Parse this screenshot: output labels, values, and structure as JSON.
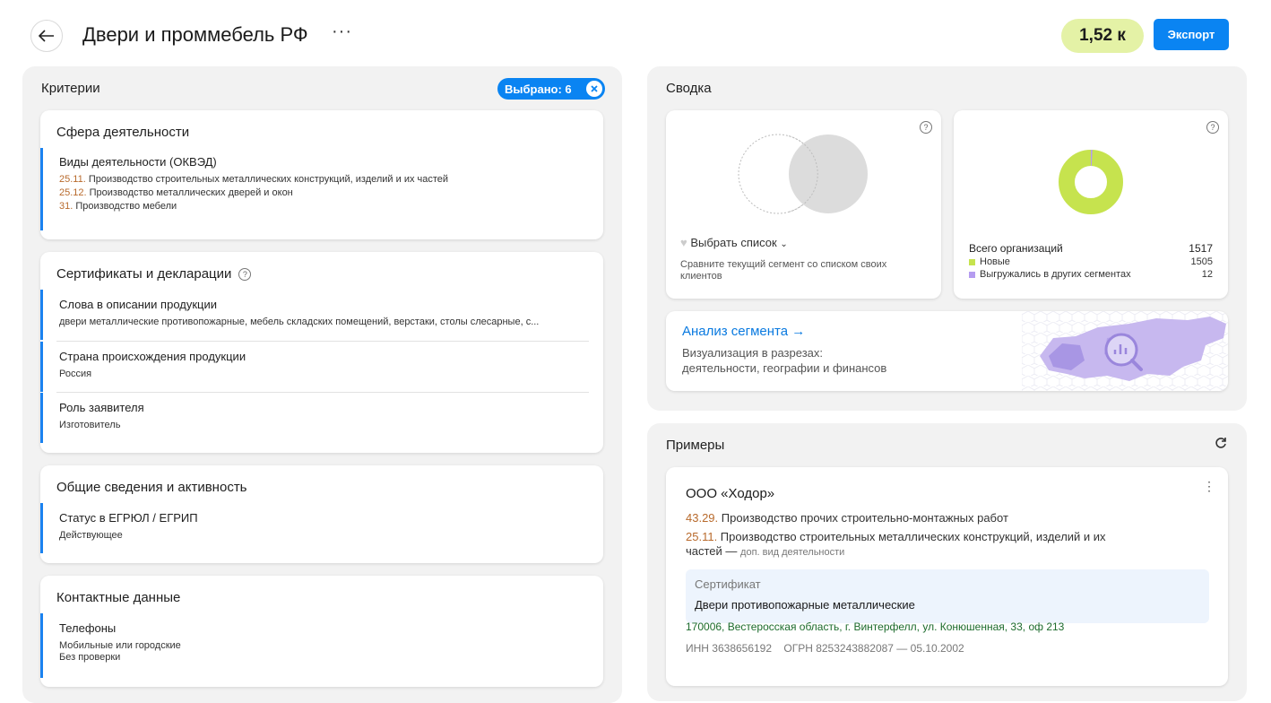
{
  "header": {
    "title": "Двери и проммебель РФ",
    "more": "···",
    "count": "1,52 к",
    "export_label": "Экспорт"
  },
  "criteria": {
    "title": "Критерии",
    "selected_label": "Выбрано: 6",
    "sections": [
      {
        "title": "Сфера деятельности",
        "items": [
          {
            "name": "Виды деятельности (ОКВЭД)",
            "lines": [
              {
                "code": "25.11.",
                "text": " Производство строительных металлических конструкций, изделий и их частей"
              },
              {
                "code": "25.12.",
                "text": " Производство металлических дверей и окон"
              },
              {
                "code": "31.",
                "text": " Производство мебели"
              }
            ]
          }
        ]
      },
      {
        "title": "Сертификаты и декларации",
        "items": [
          {
            "name": "Слова в описании продукции",
            "value": "двери металлические противопожарные, мебель складских помещений, верстаки, столы слесарные, с..."
          },
          {
            "name": "Страна происхождения продукции",
            "value": "Россия"
          },
          {
            "name": "Роль заявителя",
            "value": "Изготовитель"
          }
        ]
      },
      {
        "title": "Общие сведения и активность",
        "items": [
          {
            "name": "Статус в ЕГРЮЛ / ЕГРИП",
            "value": "Действующее"
          }
        ]
      },
      {
        "title": "Контактные данные",
        "items": [
          {
            "name": "Телефоны",
            "value": "Мобильные или городские",
            "value2": "Без проверки"
          }
        ]
      }
    ]
  },
  "summary": {
    "title": "Сводка",
    "compare": {
      "select_label": "Выбрать список",
      "description": "Сравните текущий сегмент со списком своих клиентов"
    },
    "orgs": {
      "total_label": "Всего организаций",
      "total": "1517",
      "new_label": "Новые",
      "new": "1505",
      "exported_label": "Выгружались в других сегментах",
      "exported": "12",
      "new_color": "#c6e34e",
      "exported_color": "#b59cf0"
    },
    "analysis": {
      "title": "Анализ сегмента →",
      "line1": "Визуализация в разрезах:",
      "line2": "деятельности, географии и финансов"
    }
  },
  "examples": {
    "title": "Примеры",
    "company": {
      "name": "ООО «Ходор»",
      "activity1_code": "43.29.",
      "activity1_text": " Производство прочих строительно-монтажных работ",
      "activity2_code": "25.11.",
      "activity2_text": " Производство строительных металлических конструкций, изделий и их",
      "activity2_text_cont": "частей",
      "activity2_suffix_dash": " — ",
      "activity2_suffix": "доп. вид деятельности",
      "cert_label": "Сертификат",
      "cert_value": "Двери противопожарные металлические",
      "address": "170006, Вестеросская область, г. Винтерфелл, ул. Конюшенная, 33, оф 213",
      "inn": "ИНН 3638656192",
      "ogrn": "ОГРН 8253243882087 — 05.10.2002"
    }
  }
}
